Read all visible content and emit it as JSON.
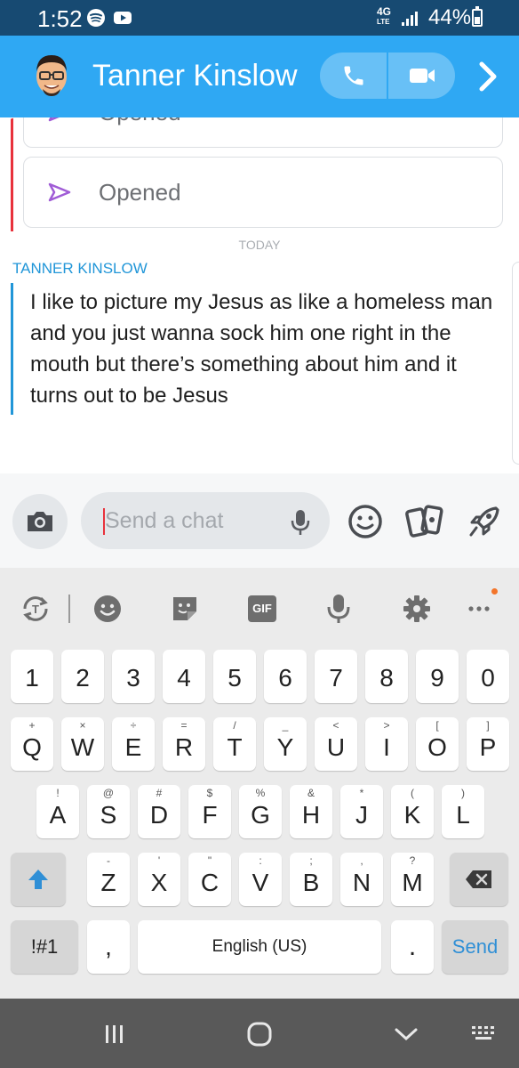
{
  "status_bar": {
    "time": "1:52",
    "network": "4G",
    "network_sub": "LTE",
    "battery": "44%"
  },
  "header": {
    "contact_name": "Tanner Kinslow",
    "accent_color": "#2fa8f3"
  },
  "chat": {
    "previous_cards": [
      {
        "label": "Opened"
      },
      {
        "label": "Opened"
      }
    ],
    "date_divider": "TODAY",
    "sender": "TANNER KINSLOW",
    "message": "I like to picture my Jesus as like a homeless man and you just wanna sock him one right in the mouth but there’s something about him and it turns out to be Jesus"
  },
  "input": {
    "placeholder": "Send a chat"
  },
  "keyboard": {
    "toolbar_gif": "GIF",
    "number_row": [
      "1",
      "2",
      "3",
      "4",
      "5",
      "6",
      "7",
      "8",
      "9",
      "0"
    ],
    "row1": [
      {
        "key": "Q",
        "sup": "+"
      },
      {
        "key": "W",
        "sup": "×"
      },
      {
        "key": "E",
        "sup": "÷"
      },
      {
        "key": "R",
        "sup": "="
      },
      {
        "key": "T",
        "sup": "/"
      },
      {
        "key": "Y",
        "sup": "_"
      },
      {
        "key": "U",
        "sup": "<"
      },
      {
        "key": "I",
        "sup": ">"
      },
      {
        "key": "O",
        "sup": "["
      },
      {
        "key": "P",
        "sup": "]"
      }
    ],
    "row2": [
      {
        "key": "A",
        "sup": "!"
      },
      {
        "key": "S",
        "sup": "@"
      },
      {
        "key": "D",
        "sup": "#"
      },
      {
        "key": "F",
        "sup": "$"
      },
      {
        "key": "G",
        "sup": "%"
      },
      {
        "key": "H",
        "sup": "&"
      },
      {
        "key": "J",
        "sup": "*"
      },
      {
        "key": "K",
        "sup": "("
      },
      {
        "key": "L",
        "sup": ")"
      }
    ],
    "row3": [
      {
        "key": "Z",
        "sup": "-"
      },
      {
        "key": "X",
        "sup": "'"
      },
      {
        "key": "C",
        "sup": "\""
      },
      {
        "key": "V",
        "sup": ":"
      },
      {
        "key": "B",
        "sup": ";"
      },
      {
        "key": "N",
        "sup": ","
      },
      {
        "key": "M",
        "sup": "?"
      }
    ],
    "symbols_label": "!#1",
    "comma_label": ",",
    "space_label": "English (US)",
    "period_label": ".",
    "send_label": "Send"
  }
}
